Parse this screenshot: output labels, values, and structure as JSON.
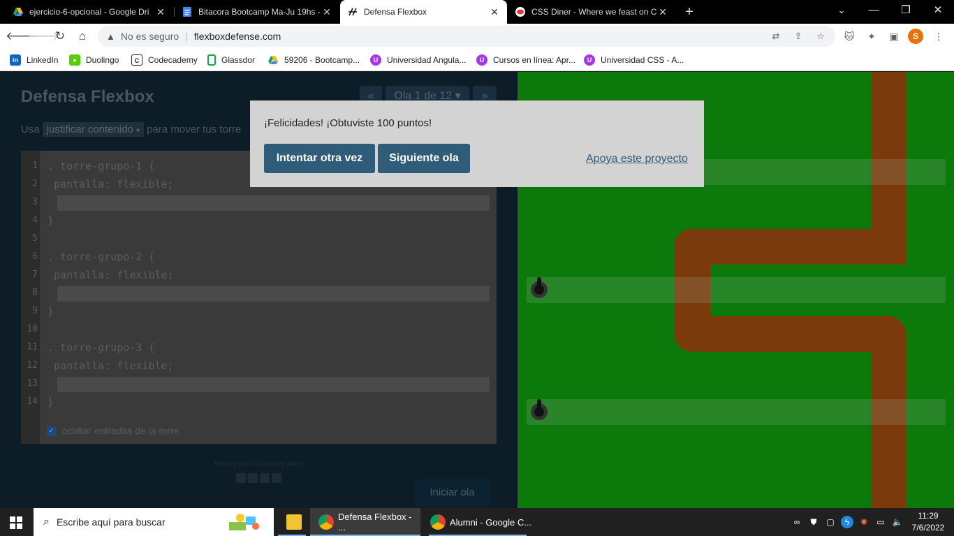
{
  "browser": {
    "tabs": [
      {
        "title": "ejercicio-6-opcional - Google Dri",
        "icon": "google-drive-icon"
      },
      {
        "title": "Bitacora Bootcamp Ma-Ju 19hs -",
        "icon": "google-docs-icon"
      },
      {
        "title": "Defensa Flexbox",
        "icon": "flexbox-defense-icon",
        "active": true
      },
      {
        "title": "CSS Diner - Where we feast on CS",
        "icon": "css-diner-icon"
      }
    ],
    "new_tab": "+",
    "window": {
      "minimize": "—",
      "restore": "❐",
      "close": "✕"
    },
    "address": {
      "security": "No es seguro",
      "url": "flexboxdefense.com"
    },
    "bookmarks": [
      {
        "label": "LinkedIn",
        "icon": "linkedin-icon",
        "color": "#0a66c2"
      },
      {
        "label": "Duolingo",
        "icon": "duolingo-icon",
        "color": "#58cc02"
      },
      {
        "label": "Codecademy",
        "icon": "codecademy-icon",
        "color": "#1f1f1f"
      },
      {
        "label": "Glassdor",
        "icon": "glassdoor-icon",
        "color": "#0caa41"
      },
      {
        "label": "59206 - Bootcamp...",
        "icon": "google-drive-icon",
        "color": "#1fa463"
      },
      {
        "label": "Universidad Angula...",
        "icon": "udemy-icon",
        "color": "#a435f0"
      },
      {
        "label": "Cursos en línea: Apr...",
        "icon": "udemy-icon",
        "color": "#a435f0"
      },
      {
        "label": "Universidad CSS - A...",
        "icon": "udemy-icon",
        "color": "#a435f0"
      }
    ],
    "profile_initial": "S"
  },
  "game": {
    "title": "Defensa Flexbox",
    "level_prev": "«",
    "level_label": "Ola 1 de 12",
    "level_caret": "▾",
    "level_next": "»",
    "instruction_pre": "Usa",
    "instruction_keyword": "justificar contenido",
    "instruction_keyword_caret": "▾",
    "instruction_post": "para mover tus torre",
    "code_lines": [
      {
        "n": "1",
        "text": ". torre-grupo-1 {"
      },
      {
        "n": "2",
        "text": " pantalla: flexible;"
      },
      {
        "n": "3",
        "text": ""
      },
      {
        "n": "4",
        "text": "}"
      },
      {
        "n": "5",
        "text": ""
      },
      {
        "n": "6",
        "text": ". torre-grupo-2 {"
      },
      {
        "n": "7",
        "text": " pantalla: flexible;"
      },
      {
        "n": "8",
        "text": ""
      },
      {
        "n": "9",
        "text": "}"
      },
      {
        "n": "10",
        "text": ""
      },
      {
        "n": "11",
        "text": ". torre-grupo-3 {"
      },
      {
        "n": "12",
        "text": " pantalla: flexible;"
      },
      {
        "n": "13",
        "text": ""
      },
      {
        "n": "14",
        "text": "}"
      }
    ],
    "hide_inputs_label": "ocultar entradas de la torre",
    "hide_inputs_checked": true,
    "start_button": "Iniciar ola",
    "footer": "Hecho por Channing Allen",
    "social_icons": [
      "facebook-icon",
      "twitter-icon",
      "linkedin-icon",
      "github-icon"
    ]
  },
  "modal": {
    "message": "¡Felicidades! ¡Obtuviste 100 puntos!",
    "retry_button": "Intentar otra vez",
    "next_button": "Siguiente ola",
    "support_link": "Apoya este proyecto"
  },
  "taskbar": {
    "search_placeholder": "Escribe aquí para buscar",
    "apps": [
      {
        "label": "",
        "icon": "file-explorer-icon"
      },
      {
        "label": "Defensa Flexbox - ...",
        "icon": "chrome-icon",
        "active": true
      },
      {
        "label": "Alumni - Google C...",
        "icon": "chrome-icon"
      }
    ],
    "time": "11:29",
    "date": "7/6/2022"
  },
  "colors": {
    "board_green": "#0b7a0b",
    "path_brown": "#7a3a0c",
    "modal_button": "#2f5d79",
    "modal_bg": "#d3d3d3"
  }
}
